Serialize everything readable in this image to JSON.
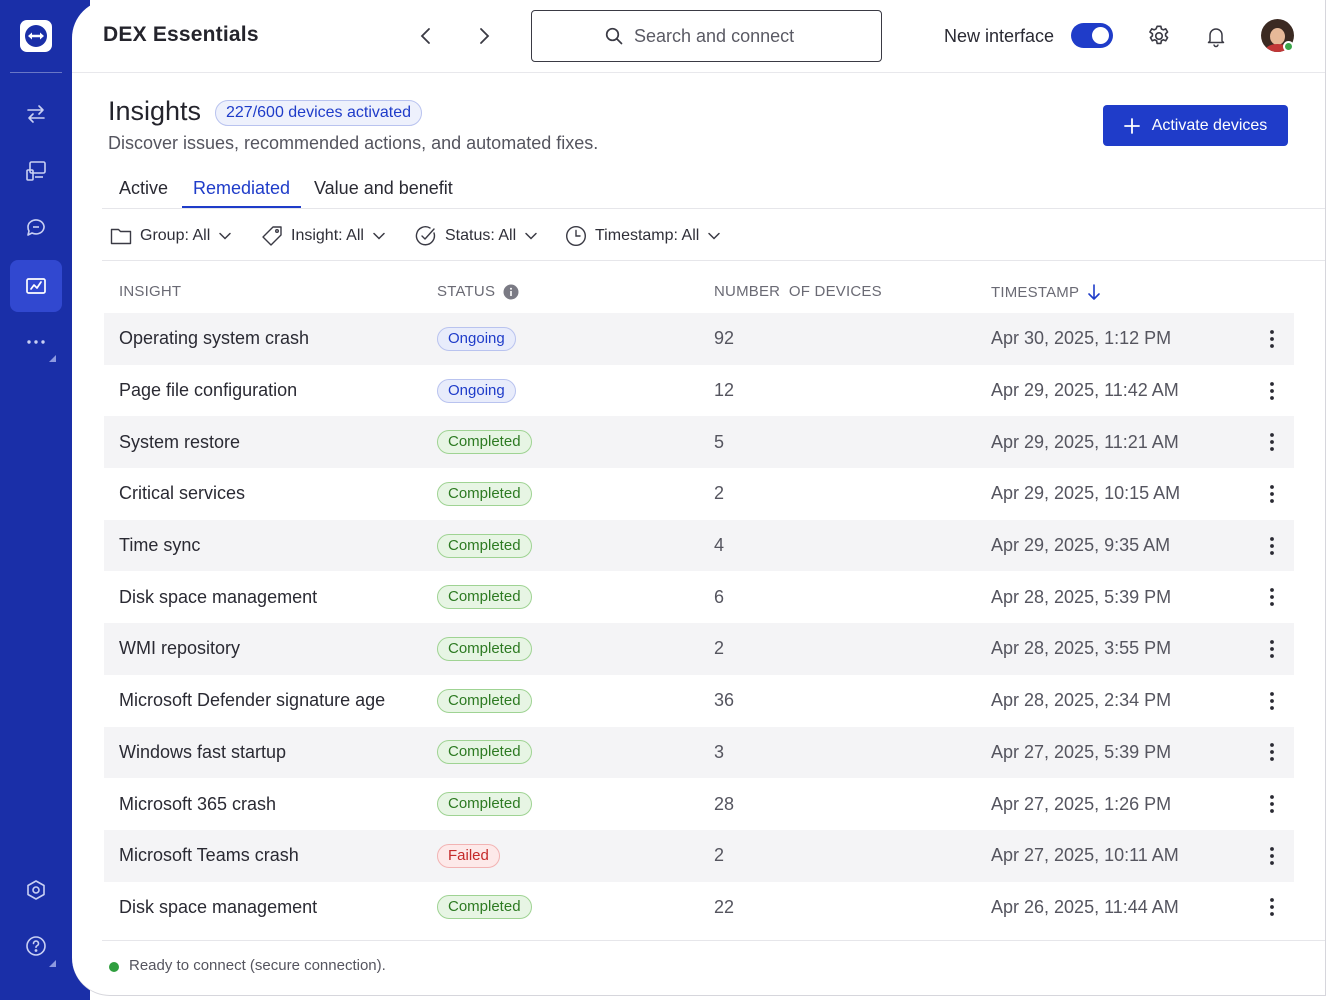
{
  "app": {
    "title": "DEX Essentials",
    "search_placeholder": "Search and connect",
    "new_interface_label": "New interface",
    "new_interface_enabled": true
  },
  "colors": {
    "rail": "#1a2fa8",
    "accent": "#1f3cc9",
    "ongoing": "#1f3cc9",
    "completed": "#2d7a22",
    "failed": "#c42a2a",
    "online": "#3aa64a"
  },
  "rail": {
    "items": [
      {
        "icon": "logo-icon"
      },
      {
        "icon": "transfer-arrows-icon"
      },
      {
        "icon": "remote-device-icon"
      },
      {
        "icon": "chat-icon"
      },
      {
        "icon": "insights-icon",
        "active": true
      },
      {
        "icon": "more-dots-icon"
      },
      {
        "icon": "admin-settings-icon"
      },
      {
        "icon": "help-icon"
      }
    ]
  },
  "page": {
    "title": "Insights",
    "badge": "227/600 devices activated",
    "subtitle": "Discover issues, recommended actions, and automated fixes.",
    "activate_button": "Activate devices"
  },
  "tabs": [
    {
      "label": "Active"
    },
    {
      "label": "Remediated",
      "active": true
    },
    {
      "label": "Value and benefit"
    }
  ],
  "filters": [
    {
      "icon": "folder-icon",
      "label": "Group: All"
    },
    {
      "icon": "tag-icon",
      "label": "Insight: All"
    },
    {
      "icon": "status-check-icon",
      "label": "Status: All"
    },
    {
      "icon": "clock-icon",
      "label": "Timestamp: All"
    }
  ],
  "table": {
    "headers": {
      "insight": "INSIGHT",
      "status": "STATUS",
      "count": "NUMBER  OF DEVICES",
      "timestamp": "TIMESTAMP"
    },
    "rows": [
      {
        "insight": "Operating system crash",
        "status": "Ongoing",
        "kind": "ongoing",
        "count": "92",
        "timestamp": "Apr 30, 2025, 1:12 PM"
      },
      {
        "insight": "Page file configuration",
        "status": "Ongoing",
        "kind": "ongoing",
        "count": "12",
        "timestamp": "Apr 29, 2025, 11:42 AM"
      },
      {
        "insight": "System restore",
        "status": "Completed",
        "kind": "completed",
        "count": "5",
        "timestamp": "Apr 29, 2025, 11:21 AM"
      },
      {
        "insight": "Critical services",
        "status": "Completed",
        "kind": "completed",
        "count": "2",
        "timestamp": "Apr 29, 2025, 10:15 AM"
      },
      {
        "insight": "Time sync",
        "status": "Completed",
        "kind": "completed",
        "count": "4",
        "timestamp": "Apr 29, 2025, 9:35 AM"
      },
      {
        "insight": "Disk space management",
        "status": "Completed",
        "kind": "completed",
        "count": "6",
        "timestamp": "Apr 28, 2025, 5:39 PM"
      },
      {
        "insight": "WMI repository",
        "status": "Completed",
        "kind": "completed",
        "count": "2",
        "timestamp": "Apr 28, 2025, 3:55 PM"
      },
      {
        "insight": "Microsoft Defender signature age",
        "status": "Completed",
        "kind": "completed",
        "count": "36",
        "timestamp": "Apr 28, 2025, 2:34 PM"
      },
      {
        "insight": "Windows fast startup",
        "status": "Completed",
        "kind": "completed",
        "count": "3",
        "timestamp": "Apr 27, 2025, 5:39 PM"
      },
      {
        "insight": "Microsoft 365 crash",
        "status": "Completed",
        "kind": "completed",
        "count": "28",
        "timestamp": "Apr 27, 2025, 1:26 PM"
      },
      {
        "insight": "Microsoft Teams crash",
        "status": "Failed",
        "kind": "failed",
        "count": "2",
        "timestamp": "Apr 27, 2025, 10:11 AM"
      },
      {
        "insight": "Disk space management",
        "status": "Completed",
        "kind": "completed",
        "count": "22",
        "timestamp": "Apr 26, 2025, 11:44 AM"
      }
    ]
  },
  "footer": {
    "status_text": "Ready to connect (secure connection)."
  }
}
